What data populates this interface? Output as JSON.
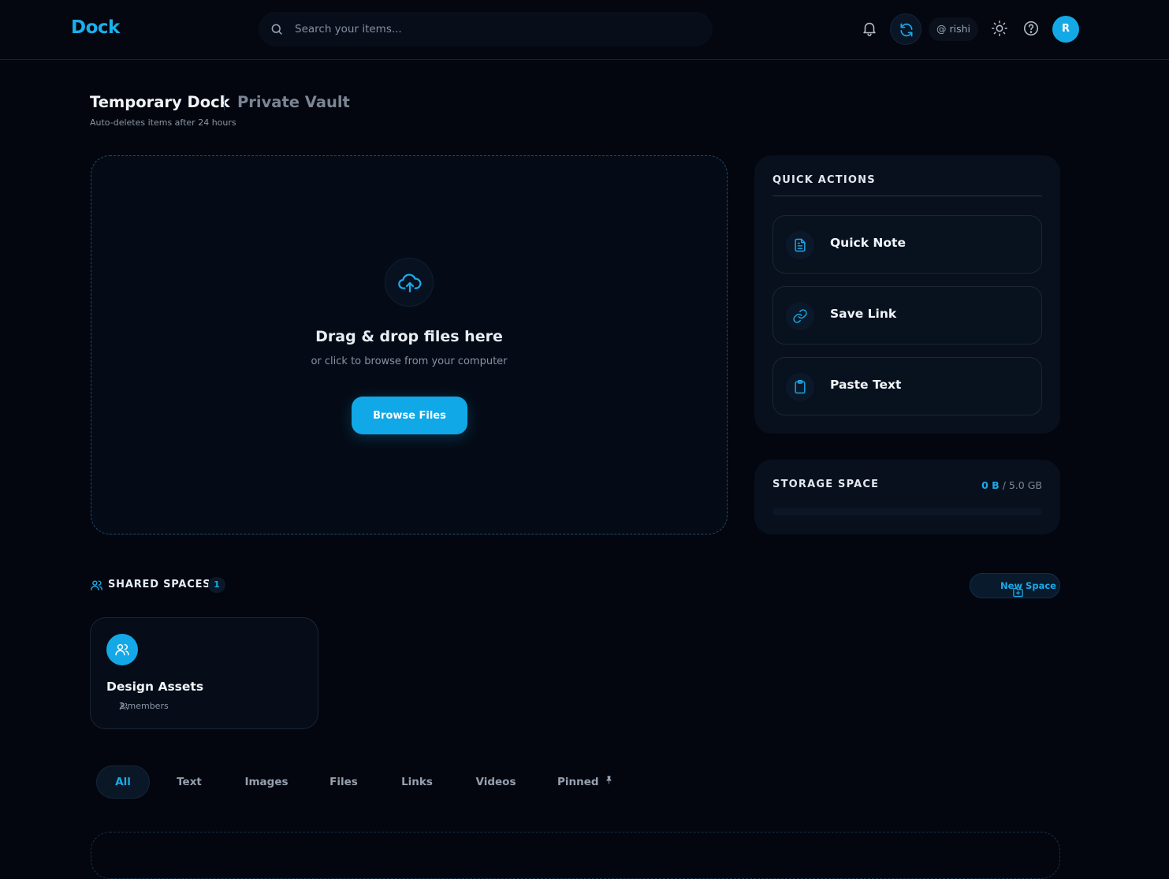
{
  "app": {
    "logo": "Dock"
  },
  "header": {
    "search_placeholder": "Search your items...",
    "username": "@ rishi",
    "avatar_initial": "R"
  },
  "page": {
    "title": "Temporary Dock",
    "alt_tab": "Private Vault",
    "subtitle": "Auto-deletes items after 24 hours"
  },
  "dropzone": {
    "title": "Drag & drop files here",
    "subtitle": "or click to browse from your computer",
    "button": "Browse Files"
  },
  "quick_actions": {
    "heading": "QUICK ACTIONS",
    "items": [
      {
        "label": "Quick Note",
        "icon": "note-icon"
      },
      {
        "label": "Save Link",
        "icon": "link-icon"
      },
      {
        "label": "Paste Text",
        "icon": "clipboard-icon"
      }
    ]
  },
  "storage": {
    "heading": "STORAGE SPACE",
    "used": "0 B",
    "total": "/ 5.0 GB",
    "used_fraction": 0
  },
  "shared_spaces": {
    "heading": "SHARED SPACES",
    "count": "1",
    "new_button": "New Space",
    "spaces": [
      {
        "name": "Design Assets",
        "members": "2 members"
      }
    ]
  },
  "filters": {
    "tabs": [
      "All",
      "Text",
      "Images",
      "Files",
      "Links",
      "Videos",
      "Pinned"
    ],
    "active": "All"
  },
  "colors": {
    "accent": "#13a9e6",
    "background": "#03060e",
    "panel": "#07101c"
  }
}
